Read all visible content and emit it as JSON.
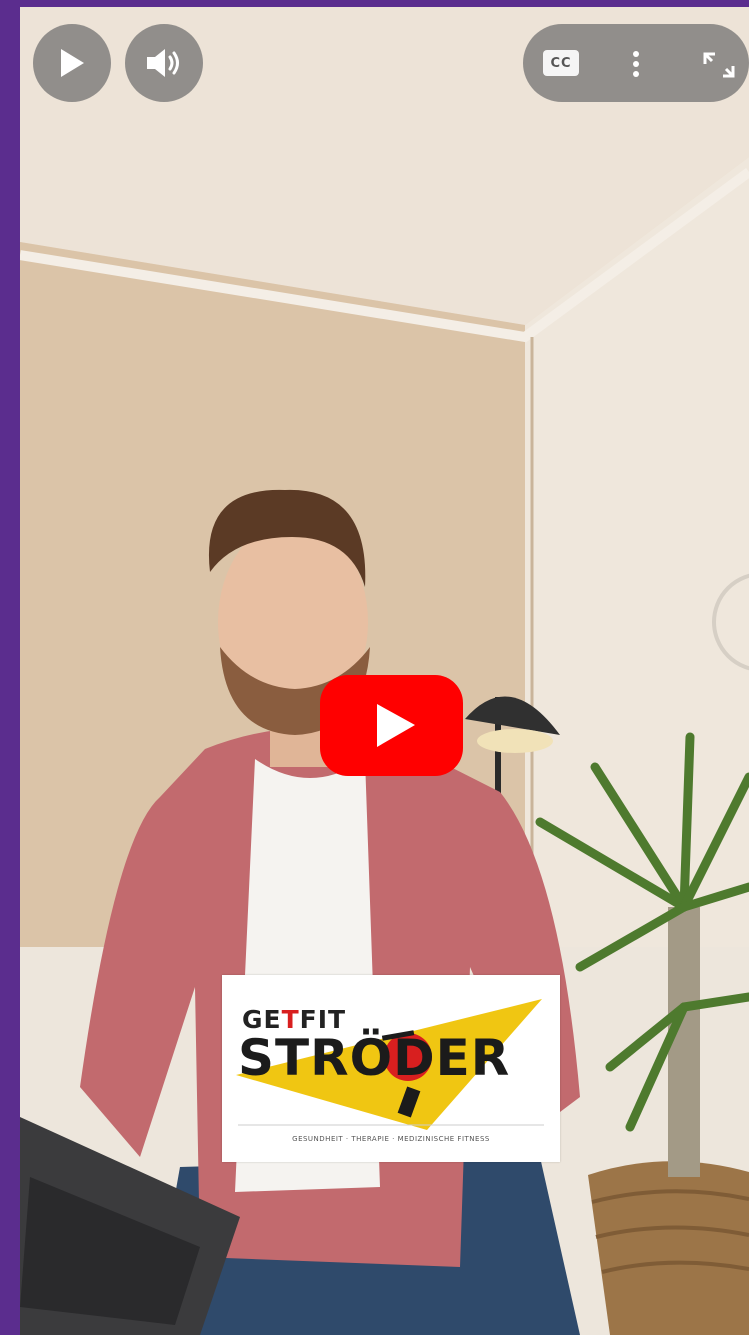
{
  "player": {
    "cc_label": "CC",
    "play_icon": "play-icon",
    "volume_icon": "volume-icon",
    "more_icon": "more-vertical-icon",
    "fullscreen_icon": "fullscreen-icon",
    "center_icon": "youtube-play-icon",
    "brand_color": "#ff0000"
  },
  "logo": {
    "getfit_prefix": "GE",
    "getfit_t": "T",
    "getfit_suffix": "FIT",
    "name": "STRÖDER",
    "tagline": "GESUNDHEIT · THERAPIE · MEDIZINISCHE FITNESS"
  }
}
